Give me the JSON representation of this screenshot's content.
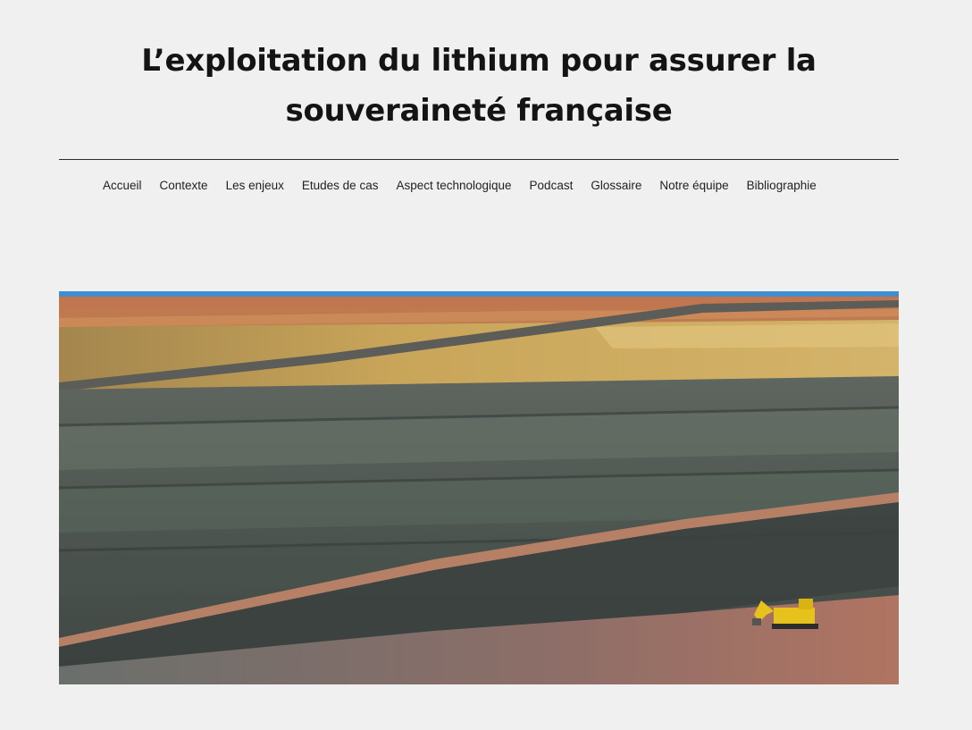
{
  "header": {
    "title_line1": "L’exploitation du lithium pour assurer la",
    "title_line2": "souveraineté française"
  },
  "nav": {
    "items": [
      {
        "label": "Accueil"
      },
      {
        "label": "Contexte"
      },
      {
        "label": "Les enjeux"
      },
      {
        "label": "Etudes de cas"
      },
      {
        "label": "Aspect technologique"
      },
      {
        "label": "Podcast"
      },
      {
        "label": "Glossaire"
      },
      {
        "label": "Notre équipe"
      },
      {
        "label": "Bibliographie"
      }
    ]
  },
  "hero": {
    "subject": "open-pit-lithium-mine-photo",
    "colors": {
      "sky": "#3f8fd0",
      "top_ochre": "#c98a4a",
      "yellow_band": "#c8a559",
      "rock_dark": "#4f5552",
      "rock_green": "#5b6759",
      "haul_road": "#b58066",
      "pit_floor": "#a87566",
      "excavator": "#e8c21c"
    }
  }
}
